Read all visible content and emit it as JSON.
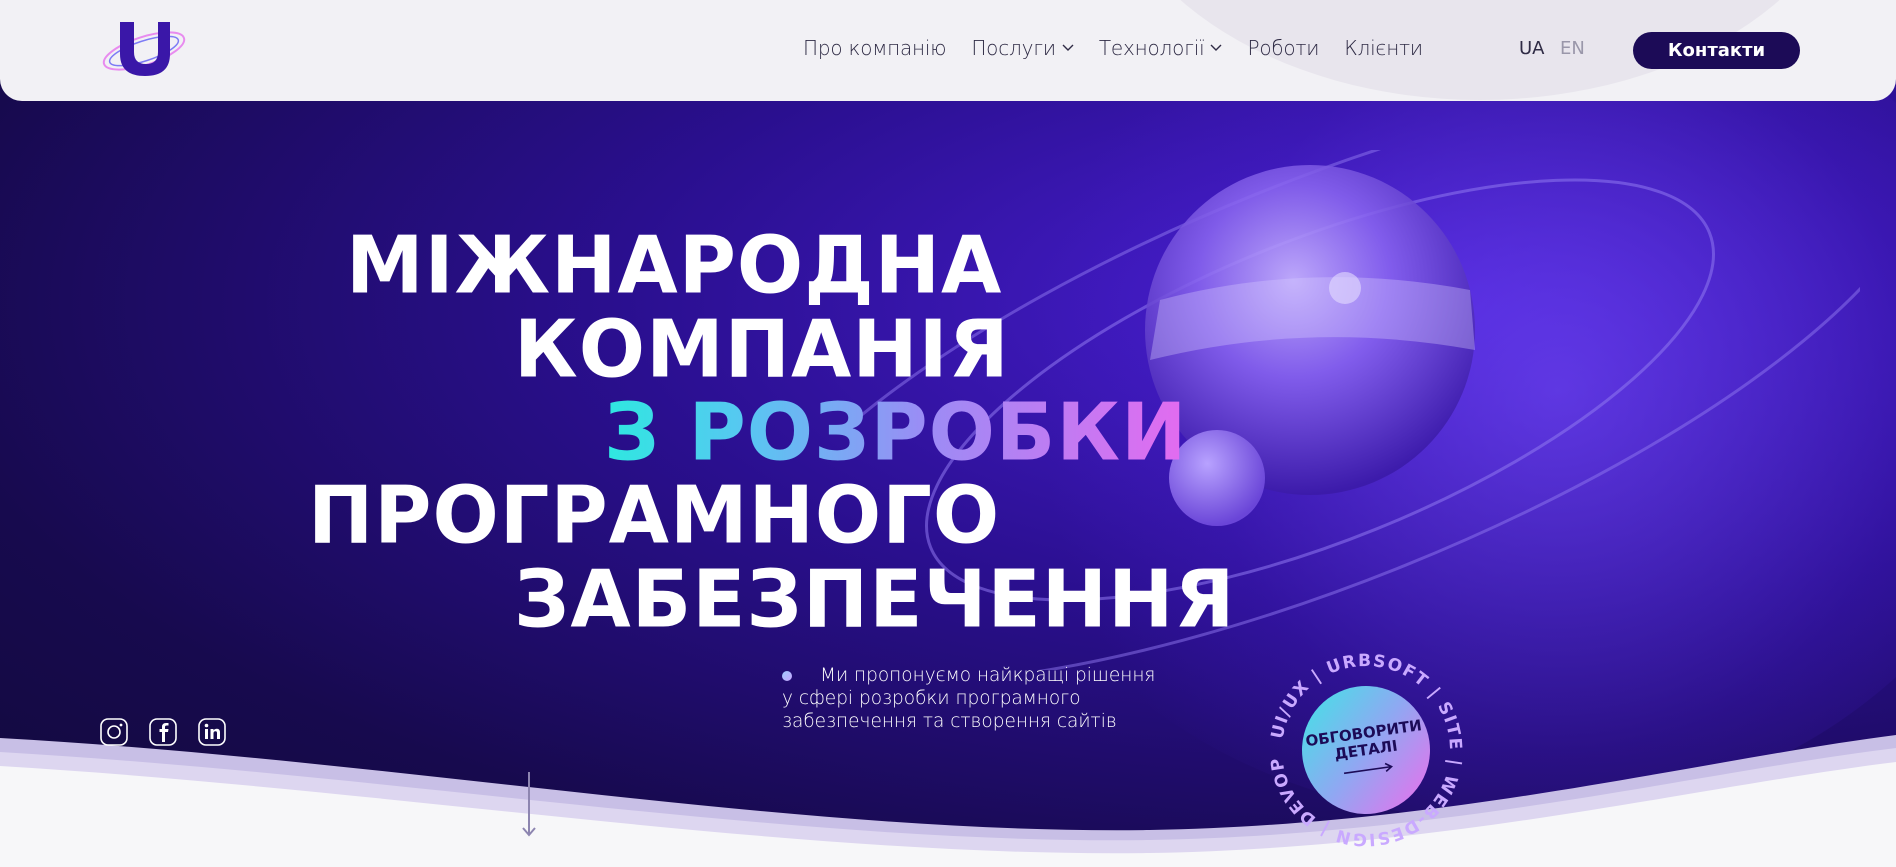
{
  "header": {
    "nav": [
      {
        "label": "Про компанію",
        "has_dropdown": false
      },
      {
        "label": "Послуги",
        "has_dropdown": true
      },
      {
        "label": "Технології",
        "has_dropdown": true
      },
      {
        "label": "Роботи",
        "has_dropdown": false
      },
      {
        "label": "Клієнти",
        "has_dropdown": false
      }
    ],
    "lang_ua": "UA",
    "lang_en": "EN",
    "contact_label": "Контакти"
  },
  "hero": {
    "headline": {
      "line1": "МІЖНАРОДНА",
      "line2": "КОМПАНІЯ",
      "line3": "З РОЗРОБКИ",
      "line4": "ПРОГРАМНОГО",
      "line5": "ЗАБЕЗПЕЧЕННЯ"
    },
    "tagline": {
      "line1": "Ми пропонуємо найкращі рішення",
      "line2": "у сфері розробки програмного",
      "line3": "забезпечення та створення сайтів"
    },
    "socials": [
      "instagram-icon",
      "facebook-icon",
      "linkedin-icon"
    ],
    "badge": {
      "center_line1": "ОБГОВОРИТИ",
      "center_line2": "ДЕТАЛІ",
      "ring_text": "UI/UX | URBSOFT | SITE | WEB-DESIGN | DEVOPS |"
    }
  },
  "colors": {
    "accent_dark": "#1c0b57",
    "hero_bg": "#170a4e",
    "gradient_start": "#2ee8e0",
    "gradient_end": "#e36bf0"
  }
}
